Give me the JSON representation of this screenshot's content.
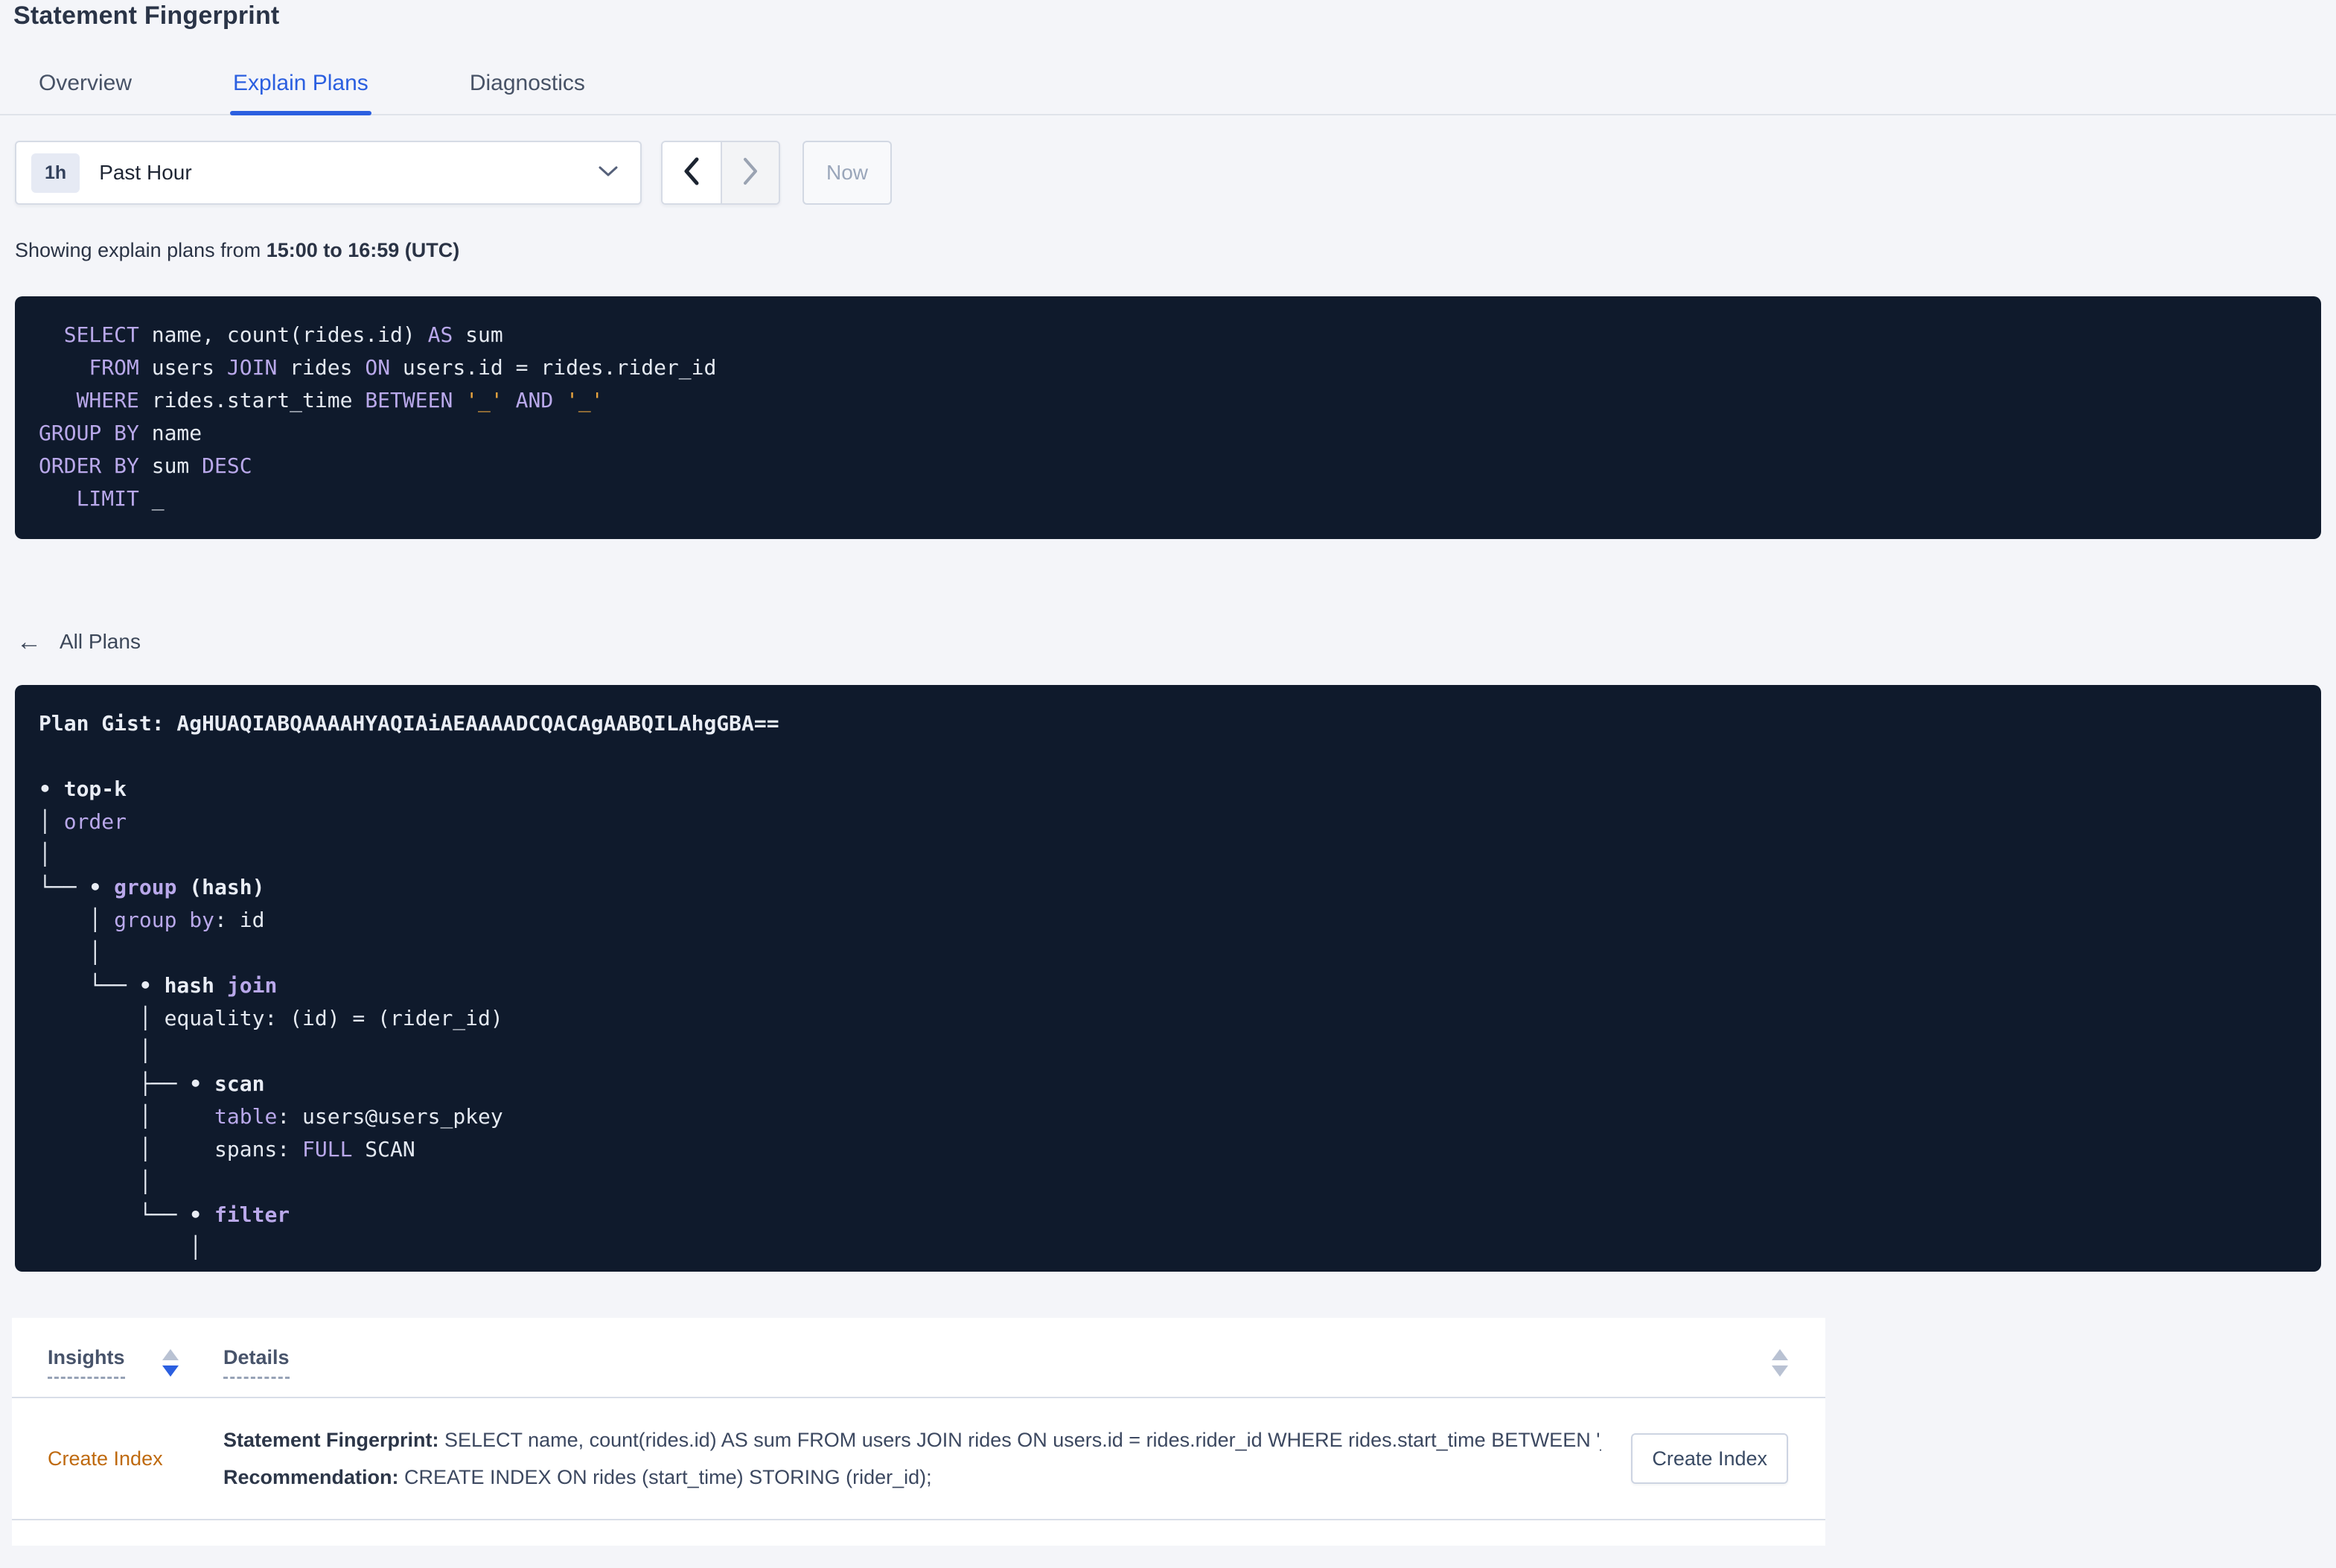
{
  "page": {
    "title": "Statement Fingerprint"
  },
  "tabs": [
    {
      "label": "Overview",
      "active": false
    },
    {
      "label": "Explain Plans",
      "active": true
    },
    {
      "label": "Diagnostics",
      "active": false
    }
  ],
  "time_picker": {
    "badge": "1h",
    "label": "Past Hour",
    "now_label": "Now"
  },
  "showing": {
    "prefix": "Showing explain plans from ",
    "range": "15:00 to 16:59 (UTC)"
  },
  "colors": {
    "accent_blue": "#2b5fe0",
    "code_background": "#0f1a2c",
    "code_keyword": "#b9a8ea",
    "code_literal": "#e8a43e",
    "insight_orange": "#bf6a0f"
  },
  "sql": {
    "lines": [
      [
        [
          "pl",
          "  "
        ],
        [
          "kw",
          "SELECT"
        ],
        [
          "id",
          " name, count(rides.id) "
        ],
        [
          "kw",
          "AS"
        ],
        [
          "id",
          " sum"
        ]
      ],
      [
        [
          "pl",
          "    "
        ],
        [
          "kw",
          "FROM"
        ],
        [
          "id",
          " users "
        ],
        [
          "kw",
          "JOIN"
        ],
        [
          "id",
          " rides "
        ],
        [
          "kw",
          "ON"
        ],
        [
          "id",
          " users.id = rides.rider_id"
        ]
      ],
      [
        [
          "pl",
          "   "
        ],
        [
          "kw",
          "WHERE"
        ],
        [
          "id",
          " rides.start_time "
        ],
        [
          "kw",
          "BETWEEN"
        ],
        [
          "id",
          " "
        ],
        [
          "lit",
          "'_'"
        ],
        [
          "id",
          " "
        ],
        [
          "kw",
          "AND"
        ],
        [
          "id",
          " "
        ],
        [
          "lit",
          "'_'"
        ]
      ],
      [
        [
          "kw",
          "GROUP BY"
        ],
        [
          "id",
          " name"
        ]
      ],
      [
        [
          "kw",
          "ORDER BY"
        ],
        [
          "id",
          " sum "
        ],
        [
          "kw",
          "DESC"
        ]
      ],
      [
        [
          "pl",
          "   "
        ],
        [
          "kw",
          "LIMIT"
        ],
        [
          "id",
          " _"
        ]
      ]
    ]
  },
  "all_plans": {
    "label": "All Plans",
    "arrow": "←"
  },
  "plan": {
    "gist": "Plan Gist: AgHUAQIABQAAAAHYAQIAiAEAAAADCQACAgAABQILAhgGBA==",
    "lines": [
      [
        [
          "b",
          "Plan Gist: AgHUAQIABQAAAAHYAQIAiAEAAAADCQACAgAABQILAhgGBA=="
        ]
      ],
      [],
      [
        [
          "b",
          "• top-k"
        ]
      ],
      [
        [
          "id",
          "│ "
        ],
        [
          "kw",
          "order"
        ]
      ],
      [
        [
          "id",
          "│"
        ]
      ],
      [
        [
          "id",
          "└── "
        ],
        [
          "b",
          "• "
        ],
        [
          "kwb",
          "group"
        ],
        [
          "b",
          " (hash)"
        ]
      ],
      [
        [
          "id",
          "    │ "
        ],
        [
          "kw",
          "group by"
        ],
        [
          "id",
          ": id"
        ]
      ],
      [
        [
          "id",
          "    │"
        ]
      ],
      [
        [
          "id",
          "    └── "
        ],
        [
          "b",
          "• hash "
        ],
        [
          "kwb",
          "join"
        ]
      ],
      [
        [
          "id",
          "        │ equality: (id) = (rider_id)"
        ]
      ],
      [
        [
          "id",
          "        │"
        ]
      ],
      [
        [
          "id",
          "        ├── "
        ],
        [
          "b",
          "• scan"
        ]
      ],
      [
        [
          "id",
          "        │     "
        ],
        [
          "kw",
          "table"
        ],
        [
          "id",
          ": users@users_pkey"
        ]
      ],
      [
        [
          "id",
          "        │     spans: "
        ],
        [
          "kw",
          "FULL"
        ],
        [
          "id",
          " SCAN"
        ]
      ],
      [
        [
          "id",
          "        │"
        ]
      ],
      [
        [
          "id",
          "        └── "
        ],
        [
          "b",
          "• "
        ],
        [
          "kwb",
          "filter"
        ]
      ],
      [
        [
          "id",
          "            │"
        ]
      ]
    ]
  },
  "insights_table": {
    "columns": {
      "insights": "Insights",
      "details": "Details"
    },
    "row": {
      "insight_type": "Create Index",
      "fingerprint_label": "Statement Fingerprint:",
      "fingerprint_text": " SELECT name, count(rides.id) AS sum FROM users JOIN rides ON users.id = rides.rider_id WHERE rides.start_time BETWEEN '_…",
      "recommendation_label": "Recommendation:",
      "recommendation_text": " CREATE INDEX ON rides (start_time) STORING (rider_id);",
      "button_label": "Create Index"
    }
  }
}
